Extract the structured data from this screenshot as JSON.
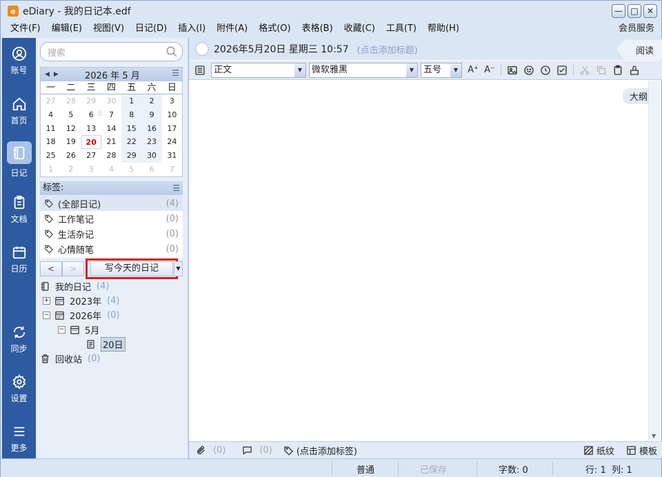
{
  "window": {
    "title": "eDiary - 我的日记本.edf",
    "app_icon": "e",
    "controls": {
      "min": "—",
      "max": "□",
      "close": "✕"
    }
  },
  "menu": {
    "items": [
      "文件(F)",
      "编辑(E)",
      "视图(V)",
      "日记(D)",
      "插入(I)",
      "附件(A)",
      "格式(O)",
      "表格(B)",
      "收藏(C)",
      "工具(T)",
      "帮助(H)"
    ],
    "right": "会员服务"
  },
  "nav": {
    "items": [
      {
        "label": "账号"
      },
      {
        "label": "首页"
      },
      {
        "label": "日记"
      },
      {
        "label": "文档"
      },
      {
        "label": "日历"
      },
      {
        "label": "同步"
      },
      {
        "label": "设置"
      },
      {
        "label": "更多"
      }
    ]
  },
  "search": {
    "placeholder": "搜索"
  },
  "calendar": {
    "month_label": "2026 年 5 月",
    "big_number": "5",
    "weekdays": [
      "一",
      "二",
      "三",
      "四",
      "五",
      "六",
      "日"
    ],
    "days": [
      "27",
      "28",
      "29",
      "30",
      "1",
      "2",
      "3",
      "4",
      "5",
      "6",
      "7",
      "8",
      "9",
      "10",
      "11",
      "12",
      "13",
      "14",
      "15",
      "16",
      "17",
      "18",
      "19",
      "20",
      "21",
      "22",
      "23",
      "24",
      "25",
      "26",
      "27",
      "28",
      "29",
      "30",
      "31",
      "1",
      "2",
      "3",
      "4",
      "5",
      "6",
      "7"
    ],
    "today": "20"
  },
  "tags": {
    "header": "标签:",
    "items": [
      {
        "label": "(全部日记)",
        "count": "(4)"
      },
      {
        "label": "工作笔记",
        "count": "(0)"
      },
      {
        "label": "生活杂记",
        "count": "(0)"
      },
      {
        "label": "心情随笔",
        "count": "(0)"
      }
    ]
  },
  "pager": {
    "prev": "<",
    "next": ">",
    "write_today": "写今天的日记",
    "dropdown": "▼"
  },
  "tree": {
    "root": {
      "label": "我的日记",
      "count": "(4)"
    },
    "y2023": {
      "label": "2023年",
      "count": "(4)",
      "exp": "+"
    },
    "y2026": {
      "label": "2026年",
      "count": "(0)",
      "exp": "−"
    },
    "month": {
      "label": "5月",
      "exp": "−"
    },
    "day": {
      "label": "20日"
    },
    "trash": {
      "label": "回收站",
      "count": "(0)"
    }
  },
  "editor": {
    "date_title": "2026年5月20日 星期三 10:57",
    "title_placeholder": "(点击添加标题)",
    "read_button": "阅读",
    "outline_button": "大纲",
    "style_select": "正文",
    "font_select": "微软雅黑",
    "size_select": "五号",
    "tb_font_up": "A⁺",
    "tb_font_down": "A⁻"
  },
  "bottom": {
    "attach_count": "(0)",
    "comment_count": "(0)",
    "tag_placeholder": "(点击添加标签)",
    "paper": "纸纹",
    "template": "模板"
  },
  "status": {
    "mode": "普通",
    "saved": "已保存",
    "word_count": "字数: 0",
    "row": "行: 1",
    "col": "列: 1"
  }
}
